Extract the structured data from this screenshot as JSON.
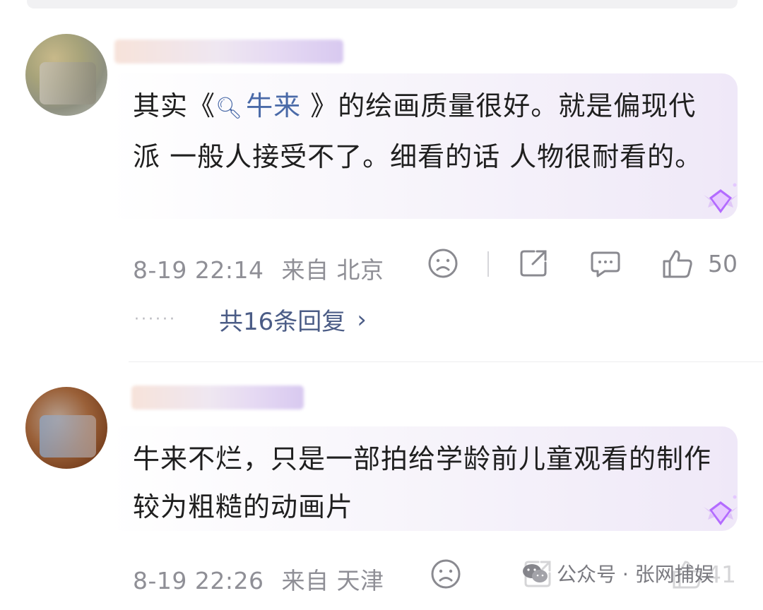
{
  "comments": [
    {
      "text_parts": [
        "其实《",
        "牛来",
        " 》的绘画质量很好。就是偏现代派 一般人接受不了。细看的话 人物很耐看的。"
      ],
      "link_icon": "search-icon",
      "time": "8-19 22:14",
      "from": "来自 北京",
      "like_count": "50",
      "replies_label": "共16条回复",
      "replies_dots": "······"
    },
    {
      "text": "牛来不烂，只是一部拍给学龄前儿童观看的制作较为粗糙的动画片",
      "time": "8-19 22:26",
      "from": "来自 天津",
      "like_count": "41"
    }
  ],
  "watermark": {
    "label": "公众号 · 张网捕娱",
    "icon": "wechat-icon"
  },
  "icons": {
    "dislike": "sad-face-icon",
    "share": "share-icon",
    "comment": "comment-icon",
    "like": "thumbs-up-icon",
    "badge": "purple-gem-badge-icon"
  },
  "colors": {
    "link": "#4a6aa8",
    "reply_link": "#4b5c86",
    "meta": "#8f8f96",
    "bubble_tint": "#efe8f8"
  }
}
